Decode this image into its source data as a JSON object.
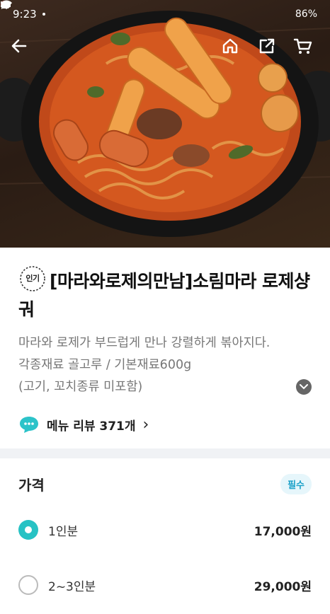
{
  "status_bar": {
    "time": "9:23",
    "battery": "86%",
    "icons": [
      "chat-bubble-icon",
      "notification-icon",
      "wifi-icon",
      "signal-icon",
      "battery-icon"
    ]
  },
  "nav": {
    "icons": [
      "back-arrow-icon",
      "home-icon",
      "share-icon",
      "cart-icon"
    ]
  },
  "product": {
    "badge": "인기",
    "title": "[마라와로제의만남]소림마라 로제샹궈",
    "description": [
      "마라와 로제가 부드럽게 만나 강렬하게 볶아지다.",
      "각종재료 골고루 / 기본재료600g",
      "(고기, 꼬치종류 미포함)"
    ],
    "review_label": "메뉴 리뷰 371개",
    "review_arrow": "›"
  },
  "price": {
    "title": "가격",
    "required_badge": "필수",
    "options": [
      {
        "label": "1인분",
        "price": "17,000원",
        "selected": true
      },
      {
        "label": "2~3인분",
        "price": "29,000원",
        "selected": false
      }
    ]
  },
  "colors": {
    "accent": "#27c2c4",
    "required_text": "#1aa0c8",
    "required_bg": "#e6f6fb",
    "divider": "#f0f2f5"
  }
}
